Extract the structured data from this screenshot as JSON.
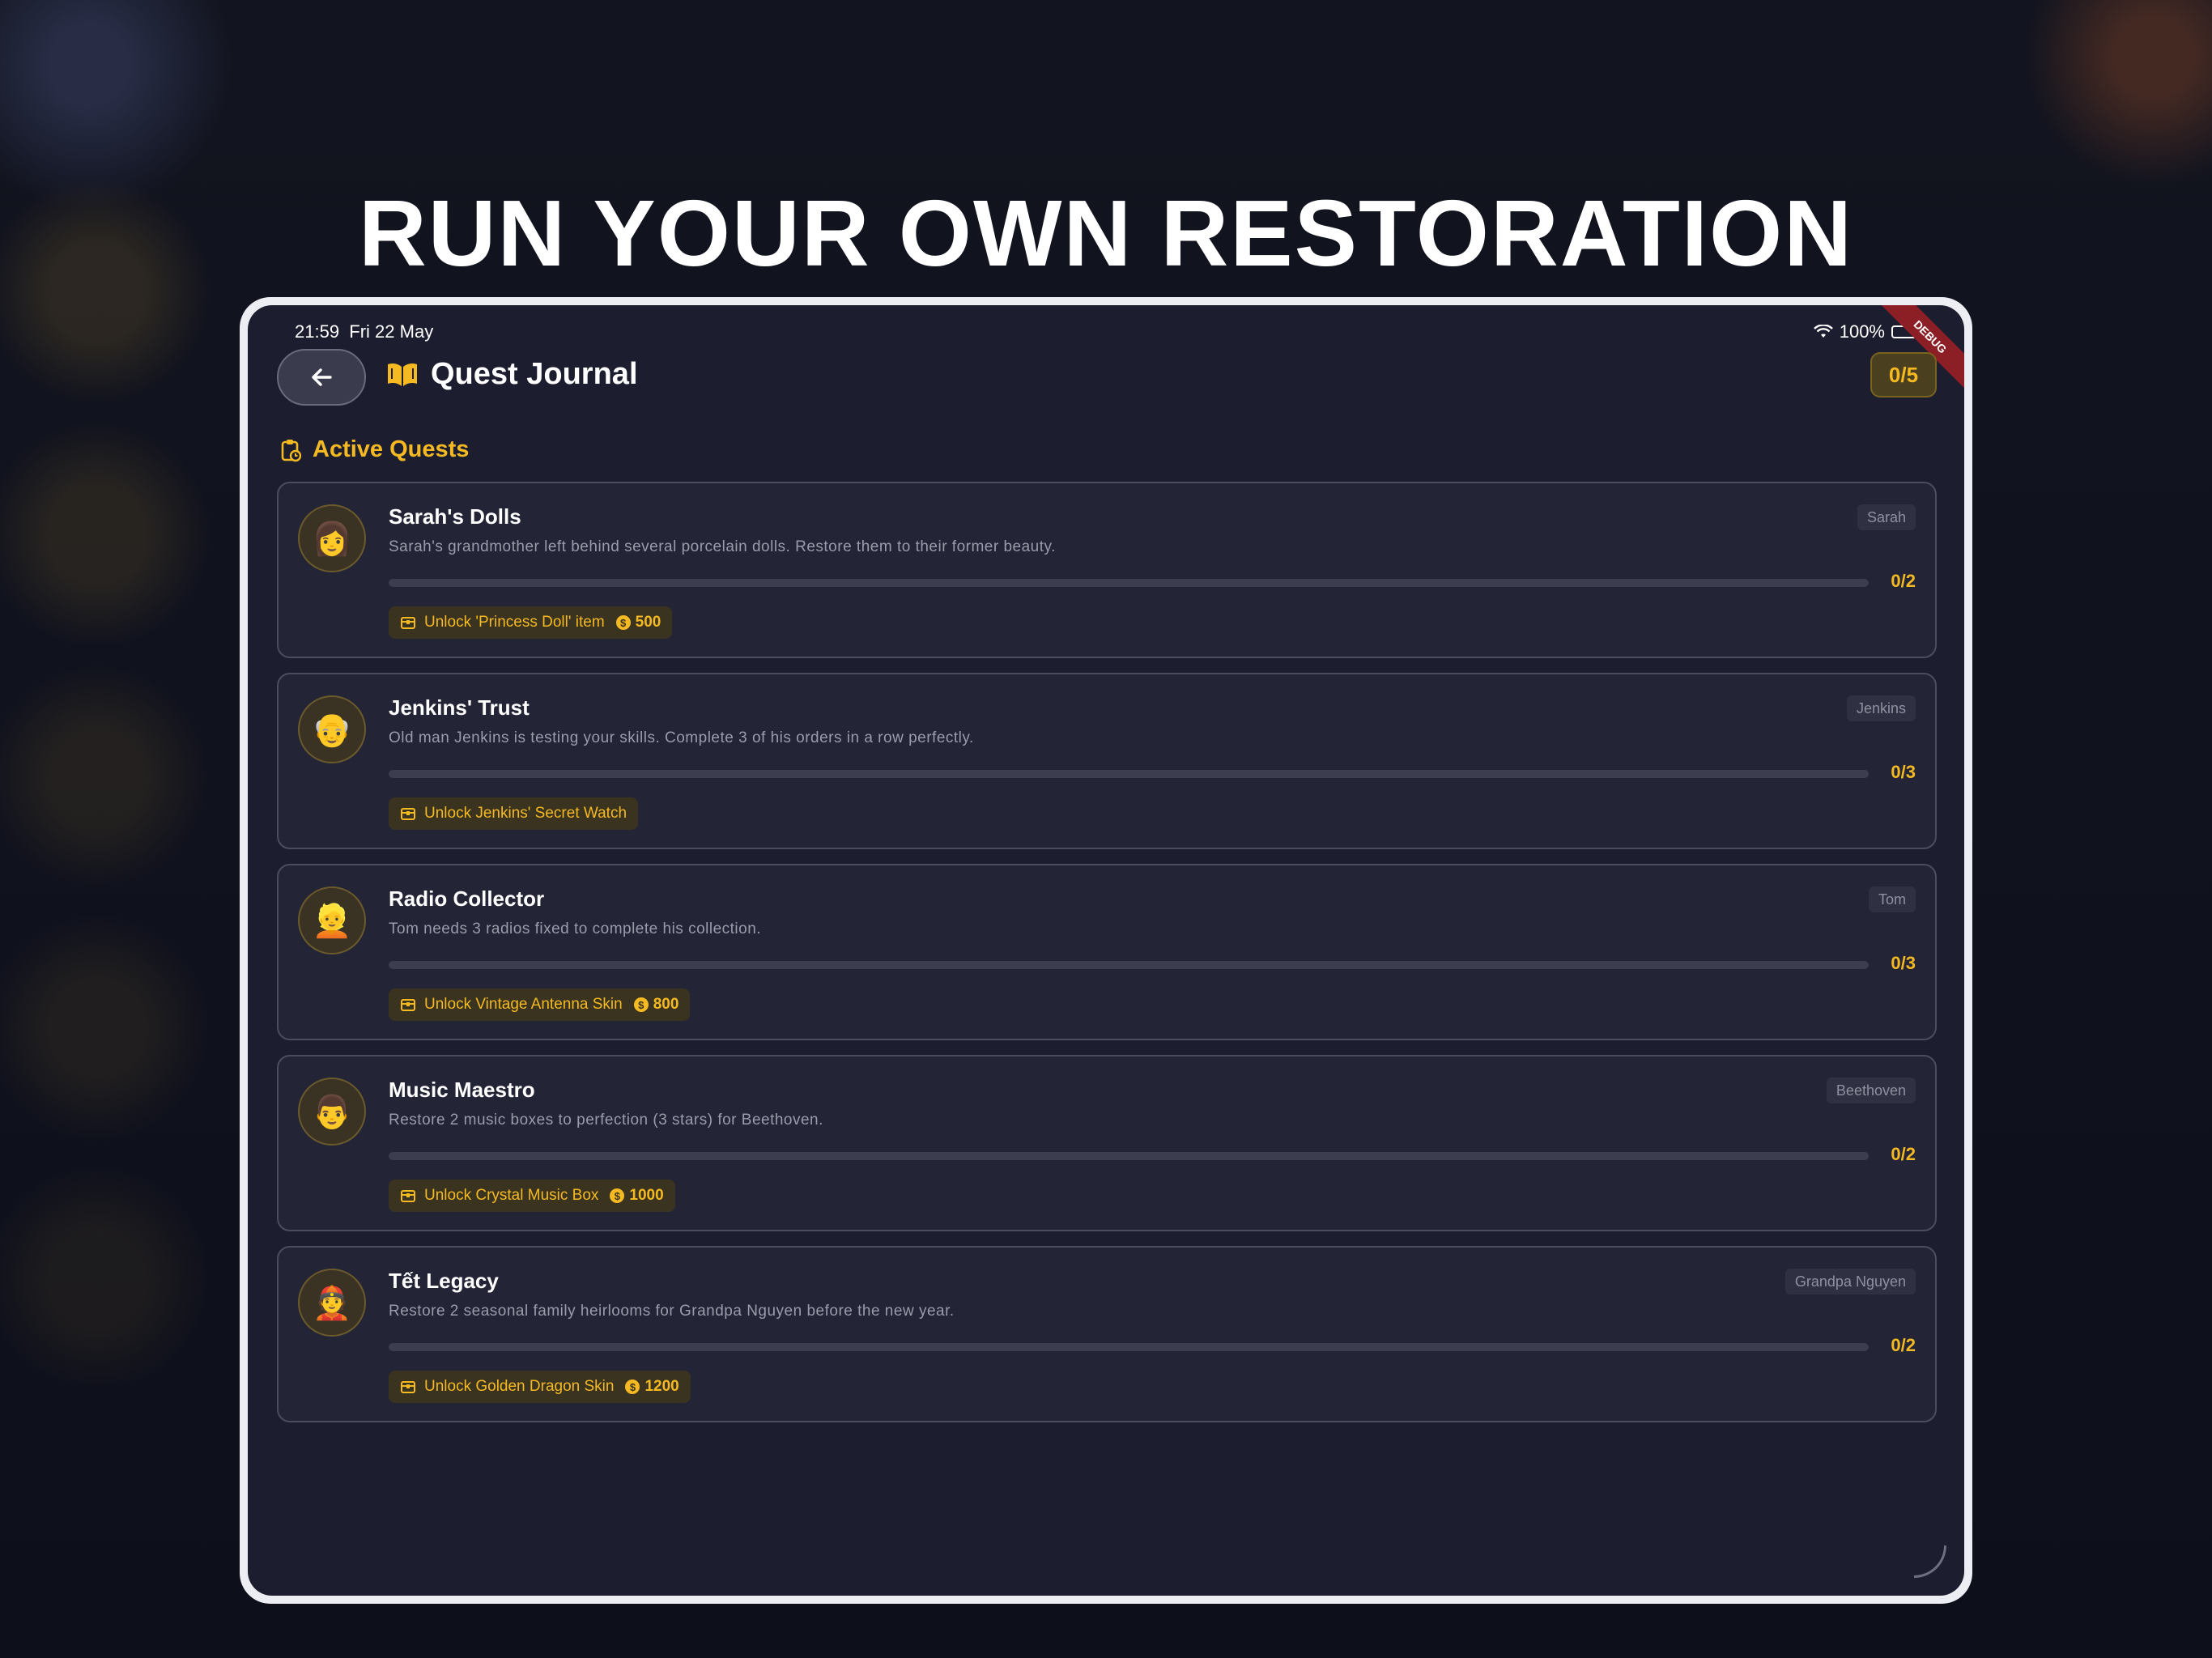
{
  "headline": "RUN YOUR OWN RESTORATION",
  "status": {
    "time": "21:59",
    "date": "Fri 22 May",
    "battery": "100%",
    "debug_label": "DEBUG"
  },
  "header": {
    "back_icon": "arrow-left-icon",
    "title_icon": "open-book-icon",
    "title": "Quest Journal",
    "progress": "0/5"
  },
  "section": {
    "icon": "clipboard-clock-icon",
    "title": "Active Quests"
  },
  "colors": {
    "accent": "#f5b922",
    "background": "#1c1e2f",
    "card": "#232536"
  },
  "quests": [
    {
      "avatar": "👩",
      "title": "Sarah's Dolls",
      "npc": "Sarah",
      "description": "Sarah's grandmother left behind several porcelain dolls. Restore them to their former beauty.",
      "progress_fraction": 0,
      "count": "0/2",
      "reward": "Unlock 'Princess Doll' item",
      "coins": "500"
    },
    {
      "avatar": "👴",
      "title": "Jenkins' Trust",
      "npc": "Jenkins",
      "description": "Old man Jenkins is testing your skills. Complete 3 of his orders in a row perfectly.",
      "progress_fraction": 0,
      "count": "0/3",
      "reward": "Unlock Jenkins' Secret Watch",
      "coins": ""
    },
    {
      "avatar": "👱",
      "title": "Radio Collector",
      "npc": "Tom",
      "description": "Tom needs 3 radios fixed to complete his collection.",
      "progress_fraction": 0,
      "count": "0/3",
      "reward": "Unlock Vintage Antenna Skin",
      "coins": "800"
    },
    {
      "avatar": "👨",
      "title": "Music Maestro",
      "npc": "Beethoven",
      "description": "Restore 2 music boxes to perfection (3 stars) for Beethoven.",
      "progress_fraction": 0,
      "count": "0/2",
      "reward": "Unlock Crystal Music Box",
      "coins": "1000"
    },
    {
      "avatar": "👲",
      "title": "Tết Legacy",
      "npc": "Grandpa Nguyen",
      "description": "Restore 2 seasonal family heirlooms for Grandpa Nguyen before the new year.",
      "progress_fraction": 0,
      "count": "0/2",
      "reward": "Unlock Golden Dragon Skin",
      "coins": "1200"
    }
  ]
}
